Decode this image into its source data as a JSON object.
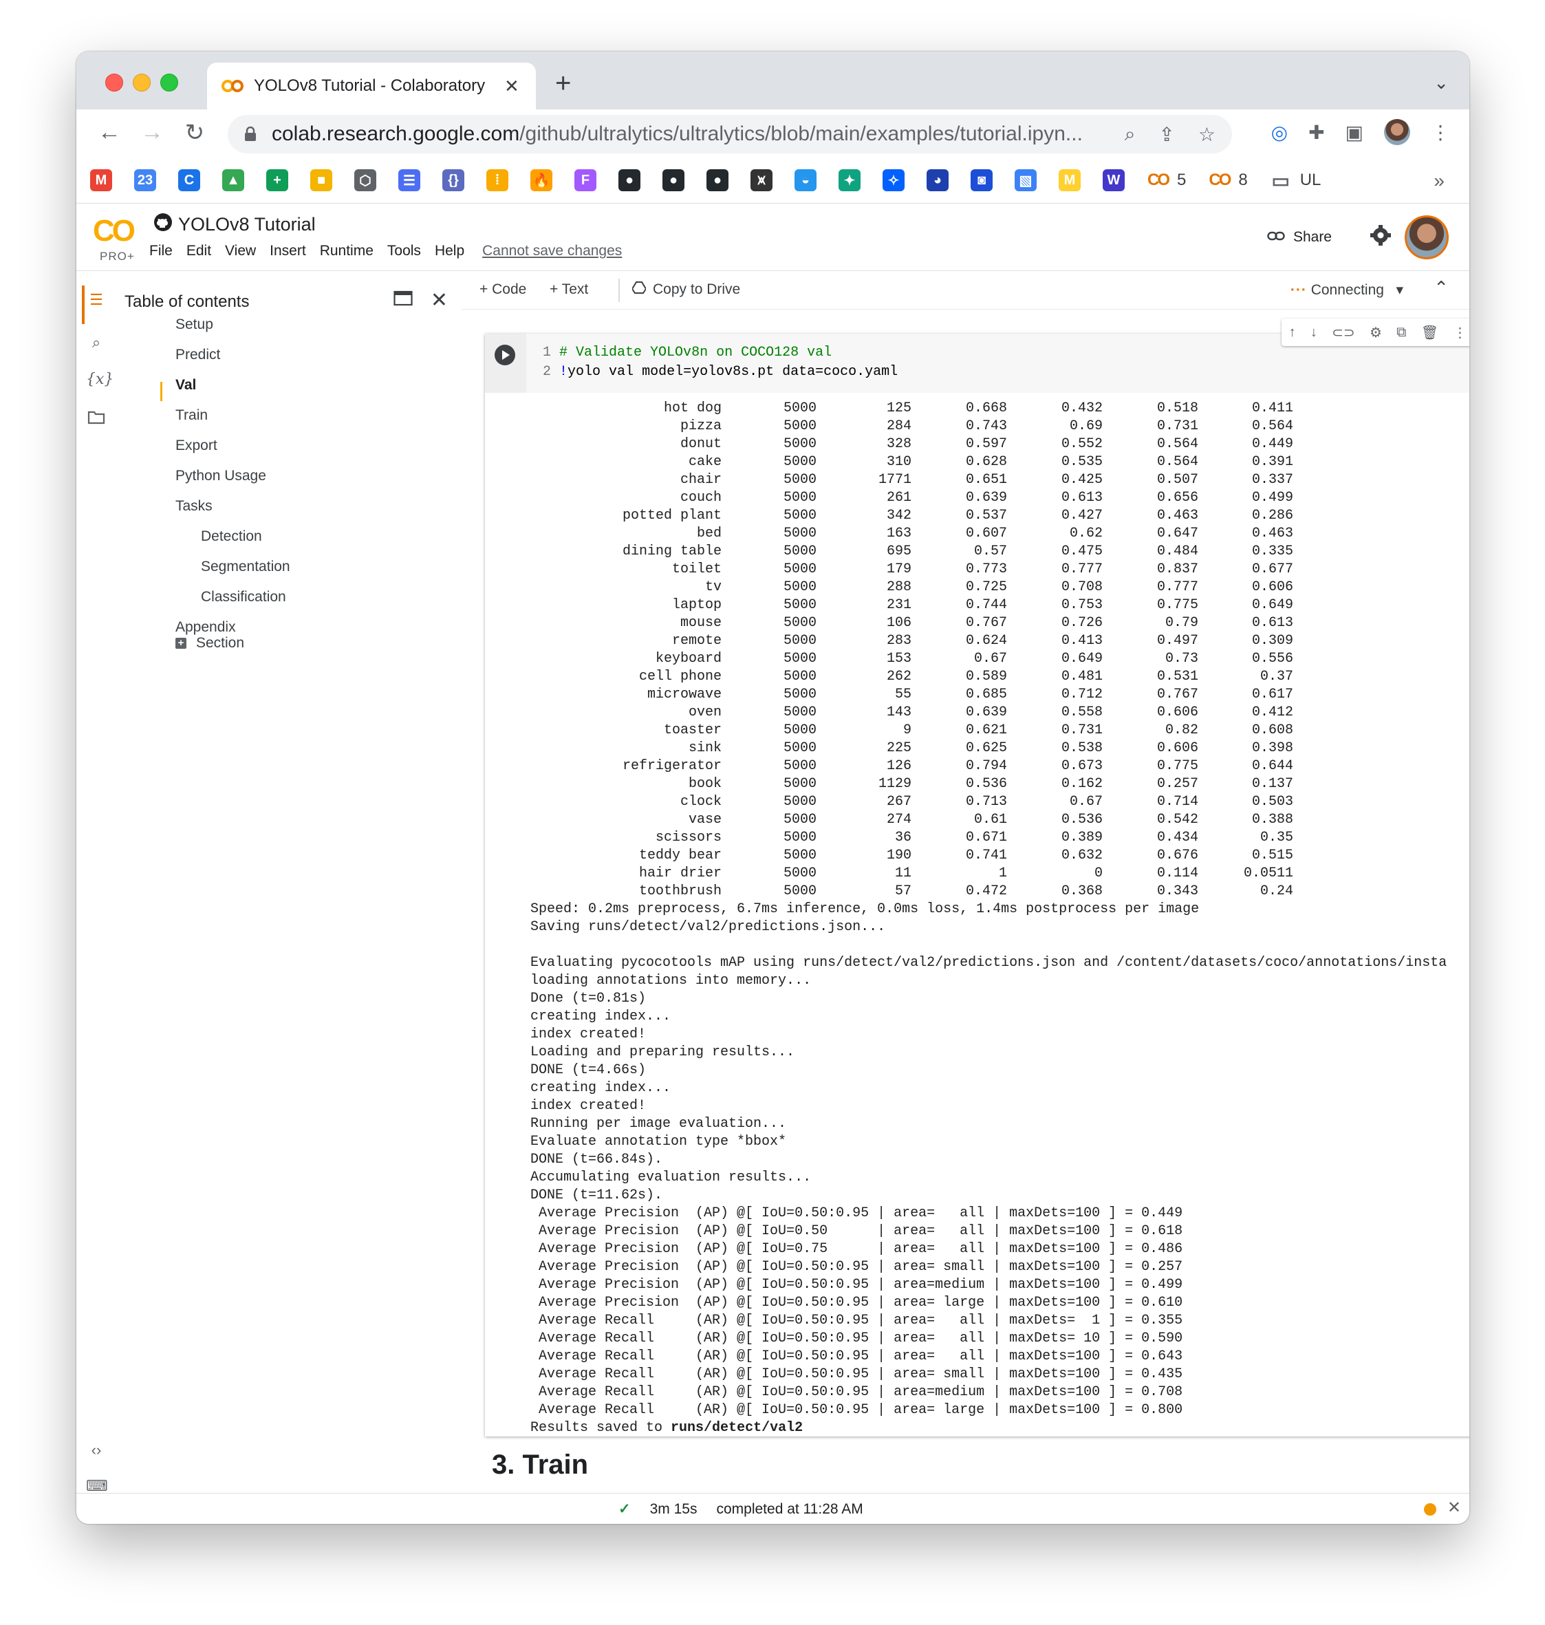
{
  "browser": {
    "tab_title": "YOLOv8 Tutorial - Colaboratory",
    "new_tab_label": "+",
    "url_host": "colab.research.google.com",
    "url_path": "/github/ultralytics/ultralytics/blob/main/examples/tutorial.ipyn...",
    "bookmarks": [
      {
        "icon": "gmail-icon",
        "color": "#ea4335",
        "text": "M"
      },
      {
        "icon": "calendar-icon",
        "color": "#4285f4",
        "text": "23"
      },
      {
        "icon": "chrome-ext-icon",
        "color": "#1a73e8",
        "text": "C"
      },
      {
        "icon": "drive-icon",
        "color": "#34a853",
        "text": "▲"
      },
      {
        "icon": "sheets-icon",
        "color": "#0f9d58",
        "text": "+"
      },
      {
        "icon": "package-icon",
        "color": "#f4b400",
        "text": "■"
      },
      {
        "icon": "settings-hex-icon",
        "color": "#5f6368",
        "text": "⬡"
      },
      {
        "icon": "table-icon",
        "color": "#4c6ef5",
        "text": "☰"
      },
      {
        "icon": "json-icon",
        "color": "#5c6bc0",
        "text": "{}"
      },
      {
        "icon": "dots-grid-icon",
        "color": "#f9ab00",
        "text": "⁞"
      },
      {
        "icon": "firebase-icon",
        "color": "#ffa000",
        "text": "🔥"
      },
      {
        "icon": "figma-icon",
        "color": "#a259ff",
        "text": "F"
      },
      {
        "icon": "github-icon",
        "color": "#24292e",
        "text": "●"
      },
      {
        "icon": "github-icon",
        "color": "#24292e",
        "text": "●"
      },
      {
        "icon": "github-icon",
        "color": "#24292e",
        "text": "●"
      },
      {
        "icon": "conda-icon",
        "color": "#333333",
        "text": "⩙"
      },
      {
        "icon": "docker-icon",
        "color": "#2496ed",
        "text": "◒"
      },
      {
        "icon": "openai-icon",
        "color": "#10a37f",
        "text": "✦"
      },
      {
        "icon": "butterfly-icon",
        "color": "#0061ff",
        "text": "✧"
      },
      {
        "icon": "blue-app-icon",
        "color": "#1e40af",
        "text": "◕"
      },
      {
        "icon": "blocks-icon",
        "color": "#1d4ed8",
        "text": "◙"
      },
      {
        "icon": "image-icon",
        "color": "#3b82f6",
        "text": "▧"
      },
      {
        "icon": "miro-icon",
        "color": "#ffd02f",
        "text": "M"
      },
      {
        "icon": "ws-icon",
        "color": "#4338ca",
        "text": "W"
      }
    ],
    "bookmark_colab_1": "5",
    "bookmark_colab_2": "8",
    "bookmark_folder": "UL",
    "bookmark_overflow": "»"
  },
  "colab": {
    "logo": "CO",
    "plan": "PRO+",
    "notebook_title": "YOLOv8 Tutorial",
    "menu": [
      "File",
      "Edit",
      "View",
      "Insert",
      "Runtime",
      "Tools",
      "Help"
    ],
    "cannot_save": "Cannot save changes",
    "share": "Share"
  },
  "toc": {
    "title": "Table of contents",
    "items": [
      {
        "label": "Setup",
        "level": 1
      },
      {
        "label": "Predict",
        "level": 1
      },
      {
        "label": "Val",
        "level": 1,
        "active": true
      },
      {
        "label": "Train",
        "level": 1
      },
      {
        "label": "Export",
        "level": 1
      },
      {
        "label": "Python Usage",
        "level": 1
      },
      {
        "label": "Tasks",
        "level": 1
      },
      {
        "label": "Detection",
        "level": 2
      },
      {
        "label": "Segmentation",
        "level": 2
      },
      {
        "label": "Classification",
        "level": 2
      },
      {
        "label": "Appendix",
        "level": 1
      }
    ],
    "section_button": "Section"
  },
  "notebook_toolbar": {
    "code": "+ Code",
    "text": "+ Text",
    "copy_drive": "Copy to Drive",
    "connecting": "Connecting"
  },
  "cell": {
    "code_lines": [
      {
        "num": "1",
        "text": "# Validate YOLOv8n on COCO128 val"
      },
      {
        "num": "2",
        "bang": "!",
        "text": "yolo val model=yolov8s.pt data=coco.yaml"
      }
    ],
    "class_rows": [
      [
        "hot dog",
        "5000",
        "125",
        "0.668",
        "0.432",
        "0.518",
        "0.411"
      ],
      [
        "pizza",
        "5000",
        "284",
        "0.743",
        "0.69",
        "0.731",
        "0.564"
      ],
      [
        "donut",
        "5000",
        "328",
        "0.597",
        "0.552",
        "0.564",
        "0.449"
      ],
      [
        "cake",
        "5000",
        "310",
        "0.628",
        "0.535",
        "0.564",
        "0.391"
      ],
      [
        "chair",
        "5000",
        "1771",
        "0.651",
        "0.425",
        "0.507",
        "0.337"
      ],
      [
        "couch",
        "5000",
        "261",
        "0.639",
        "0.613",
        "0.656",
        "0.499"
      ],
      [
        "potted plant",
        "5000",
        "342",
        "0.537",
        "0.427",
        "0.463",
        "0.286"
      ],
      [
        "bed",
        "5000",
        "163",
        "0.607",
        "0.62",
        "0.647",
        "0.463"
      ],
      [
        "dining table",
        "5000",
        "695",
        "0.57",
        "0.475",
        "0.484",
        "0.335"
      ],
      [
        "toilet",
        "5000",
        "179",
        "0.773",
        "0.777",
        "0.837",
        "0.677"
      ],
      [
        "tv",
        "5000",
        "288",
        "0.725",
        "0.708",
        "0.777",
        "0.606"
      ],
      [
        "laptop",
        "5000",
        "231",
        "0.744",
        "0.753",
        "0.775",
        "0.649"
      ],
      [
        "mouse",
        "5000",
        "106",
        "0.767",
        "0.726",
        "0.79",
        "0.613"
      ],
      [
        "remote",
        "5000",
        "283",
        "0.624",
        "0.413",
        "0.497",
        "0.309"
      ],
      [
        "keyboard",
        "5000",
        "153",
        "0.67",
        "0.649",
        "0.73",
        "0.556"
      ],
      [
        "cell phone",
        "5000",
        "262",
        "0.589",
        "0.481",
        "0.531",
        "0.37"
      ],
      [
        "microwave",
        "5000",
        "55",
        "0.685",
        "0.712",
        "0.767",
        "0.617"
      ],
      [
        "oven",
        "5000",
        "143",
        "0.639",
        "0.558",
        "0.606",
        "0.412"
      ],
      [
        "toaster",
        "5000",
        "9",
        "0.621",
        "0.731",
        "0.82",
        "0.608"
      ],
      [
        "sink",
        "5000",
        "225",
        "0.625",
        "0.538",
        "0.606",
        "0.398"
      ],
      [
        "refrigerator",
        "5000",
        "126",
        "0.794",
        "0.673",
        "0.775",
        "0.644"
      ],
      [
        "book",
        "5000",
        "1129",
        "0.536",
        "0.162",
        "0.257",
        "0.137"
      ],
      [
        "clock",
        "5000",
        "267",
        "0.713",
        "0.67",
        "0.714",
        "0.503"
      ],
      [
        "vase",
        "5000",
        "274",
        "0.61",
        "0.536",
        "0.542",
        "0.388"
      ],
      [
        "scissors",
        "5000",
        "36",
        "0.671",
        "0.389",
        "0.434",
        "0.35"
      ],
      [
        "teddy bear",
        "5000",
        "190",
        "0.741",
        "0.632",
        "0.676",
        "0.515"
      ],
      [
        "hair drier",
        "5000",
        "11",
        "1",
        "0",
        "0.114",
        "0.0511"
      ],
      [
        "toothbrush",
        "5000",
        "57",
        "0.472",
        "0.368",
        "0.343",
        "0.24"
      ]
    ],
    "log_lines": [
      "Speed: 0.2ms preprocess, 6.7ms inference, 0.0ms loss, 1.4ms postprocess per image",
      "Saving runs/detect/val2/predictions.json...",
      "",
      "Evaluating pycocotools mAP using runs/detect/val2/predictions.json and /content/datasets/coco/annotations/insta",
      "loading annotations into memory...",
      "Done (t=0.81s)",
      "creating index...",
      "index created!",
      "Loading and preparing results...",
      "DONE (t=4.66s)",
      "creating index...",
      "index created!",
      "Running per image evaluation...",
      "Evaluate annotation type *bbox*",
      "DONE (t=66.84s).",
      "Accumulating evaluation results...",
      "DONE (t=11.62s).",
      " Average Precision  (AP) @[ IoU=0.50:0.95 | area=   all | maxDets=100 ] = 0.449",
      " Average Precision  (AP) @[ IoU=0.50      | area=   all | maxDets=100 ] = 0.618",
      " Average Precision  (AP) @[ IoU=0.75      | area=   all | maxDets=100 ] = 0.486",
      " Average Precision  (AP) @[ IoU=0.50:0.95 | area= small | maxDets=100 ] = 0.257",
      " Average Precision  (AP) @[ IoU=0.50:0.95 | area=medium | maxDets=100 ] = 0.499",
      " Average Precision  (AP) @[ IoU=0.50:0.95 | area= large | maxDets=100 ] = 0.610",
      " Average Recall     (AR) @[ IoU=0.50:0.95 | area=   all | maxDets=  1 ] = 0.355",
      " Average Recall     (AR) @[ IoU=0.50:0.95 | area=   all | maxDets= 10 ] = 0.590",
      " Average Recall     (AR) @[ IoU=0.50:0.95 | area=   all | maxDets=100 ] = 0.643",
      " Average Recall     (AR) @[ IoU=0.50:0.95 | area= small | maxDets=100 ] = 0.435",
      " Average Recall     (AR) @[ IoU=0.50:0.95 | area=medium | maxDets=100 ] = 0.708",
      " Average Recall     (AR) @[ IoU=0.50:0.95 | area= large | maxDets=100 ] = 0.800"
    ],
    "results_prefix": "Results saved to ",
    "results_path": "runs/detect/val2"
  },
  "next_section_peek": "3. Train",
  "status": {
    "duration": "3m 15s",
    "completed": "completed at 11:28 AM"
  }
}
